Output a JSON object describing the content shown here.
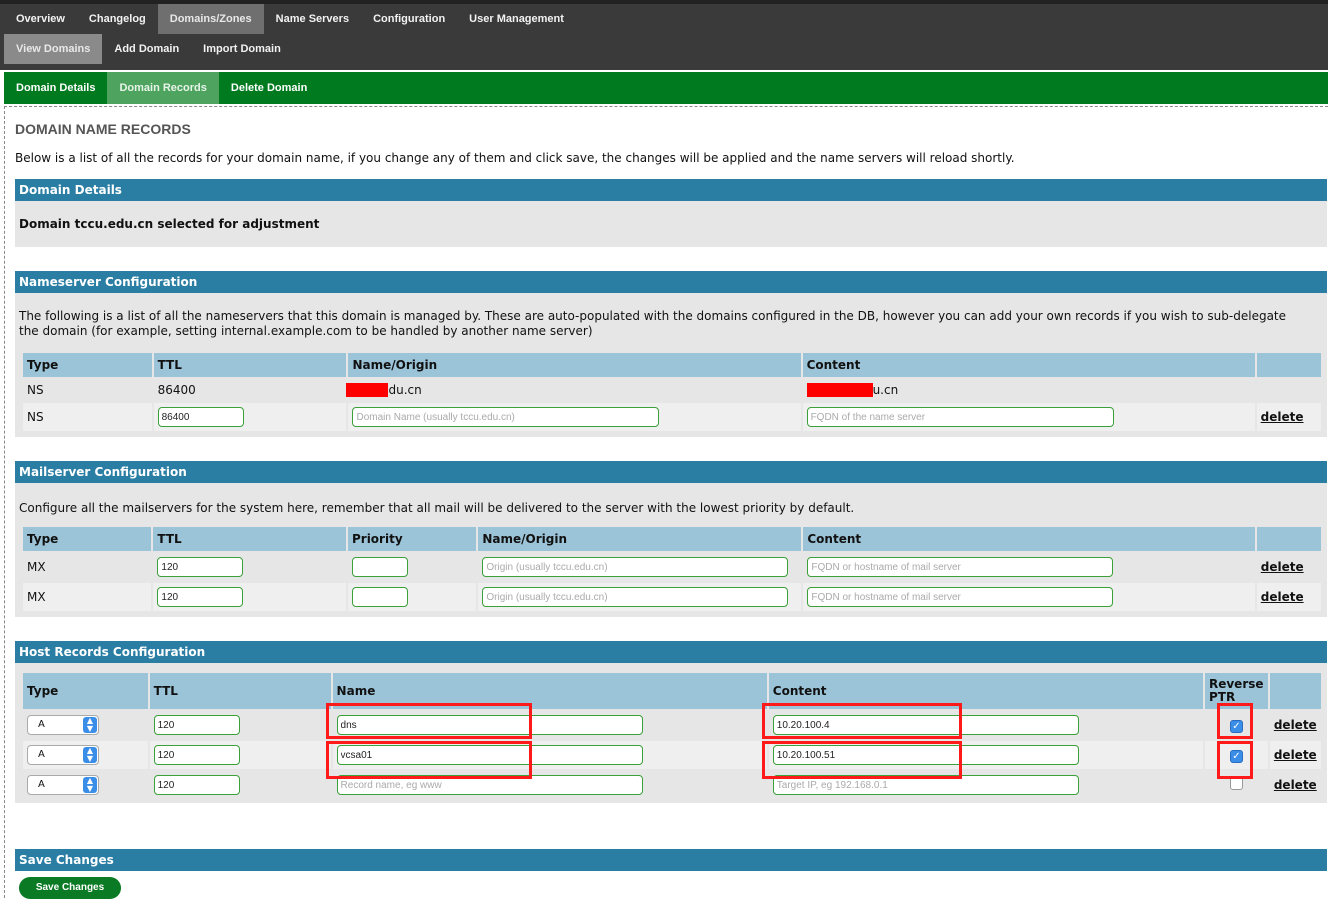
{
  "topnav": {
    "row1": [
      {
        "label": "Overview",
        "active": false
      },
      {
        "label": "Changelog",
        "active": false
      },
      {
        "label": "Domains/Zones",
        "active": true
      },
      {
        "label": "Name Servers",
        "active": false
      },
      {
        "label": "Configuration",
        "active": false
      },
      {
        "label": "User Management",
        "active": false
      }
    ],
    "row2": [
      {
        "label": "View Domains",
        "active": true
      },
      {
        "label": "Add Domain",
        "active": false
      },
      {
        "label": "Import Domain",
        "active": false
      }
    ]
  },
  "subnav": [
    {
      "label": "Domain Details",
      "active": false
    },
    {
      "label": "Domain Records",
      "active": true
    },
    {
      "label": "Delete Domain",
      "active": false
    }
  ],
  "page": {
    "title": "DOMAIN NAME RECORDS",
    "intro": "Below is a list of all the records for your domain name, if you change any of them and click save, the changes will be applied and the name servers will reload shortly."
  },
  "domain_details": {
    "header": "Domain Details",
    "text": "Domain tccu.edu.cn selected for adjustment"
  },
  "nameserver": {
    "header": "Nameserver Configuration",
    "desc": "The following is a list of all the nameservers that this domain is managed by. These are auto-populated with the domains configured in the DB, however you can add your own records if you wish to sub-delegate the domain (for example, setting internal.example.com to be handled by another name server)",
    "columns": [
      "Type",
      "TTL",
      "Name/Origin",
      "Content"
    ],
    "static_row": {
      "type": "NS",
      "ttl": "86400",
      "name_suffix": "du.cn",
      "content_suffix": "u.cn"
    },
    "edit_row": {
      "type": "NS",
      "ttl": "86400",
      "name_placeholder": "Domain Name (usually tccu.edu.cn)",
      "content_placeholder": "FQDN of the name server",
      "delete": "delete"
    }
  },
  "mailserver": {
    "header": "Mailserver Configuration",
    "desc": "Configure all the mailservers for the system here, remember that all mail will be delivered to the server with the lowest priority by default.",
    "columns": [
      "Type",
      "TTL",
      "Priority",
      "Name/Origin",
      "Content"
    ],
    "rows": [
      {
        "type": "MX",
        "ttl": "120",
        "priority": "",
        "origin_placeholder": "Origin (usually tccu.edu.cn)",
        "content_placeholder": "FQDN or hostname of mail server",
        "delete": "delete"
      },
      {
        "type": "MX",
        "ttl": "120",
        "priority": "",
        "origin_placeholder": "Origin (usually tccu.edu.cn)",
        "content_placeholder": "FQDN or hostname of mail server",
        "delete": "delete"
      }
    ]
  },
  "hosts": {
    "header": "Host Records Configuration",
    "columns": [
      "Type",
      "TTL",
      "Name",
      "Content",
      "Reverse PTR"
    ],
    "rows": [
      {
        "type": "A",
        "ttl": "120",
        "name": "dns",
        "name_placeholder": "",
        "content": "10.20.100.4",
        "content_placeholder": "",
        "ptr": true,
        "delete": "delete"
      },
      {
        "type": "A",
        "ttl": "120",
        "name": "vcsa01",
        "name_placeholder": "",
        "content": "10.20.100.51",
        "content_placeholder": "",
        "ptr": true,
        "delete": "delete"
      },
      {
        "type": "A",
        "ttl": "120",
        "name": "",
        "name_placeholder": "Record name, eg www",
        "content": "",
        "content_placeholder": "Target IP, eg 192.168.0.1",
        "ptr": false,
        "delete": "delete"
      }
    ]
  },
  "save": {
    "header": "Save Changes",
    "button": "Save Changes"
  },
  "colors": {
    "topnav_bg": "#3a3a3a",
    "subnav_bg": "#007a1f",
    "section_header": "#2a7ea4",
    "table_header": "#9cc4d8",
    "highlight": "#ff1a1a"
  }
}
